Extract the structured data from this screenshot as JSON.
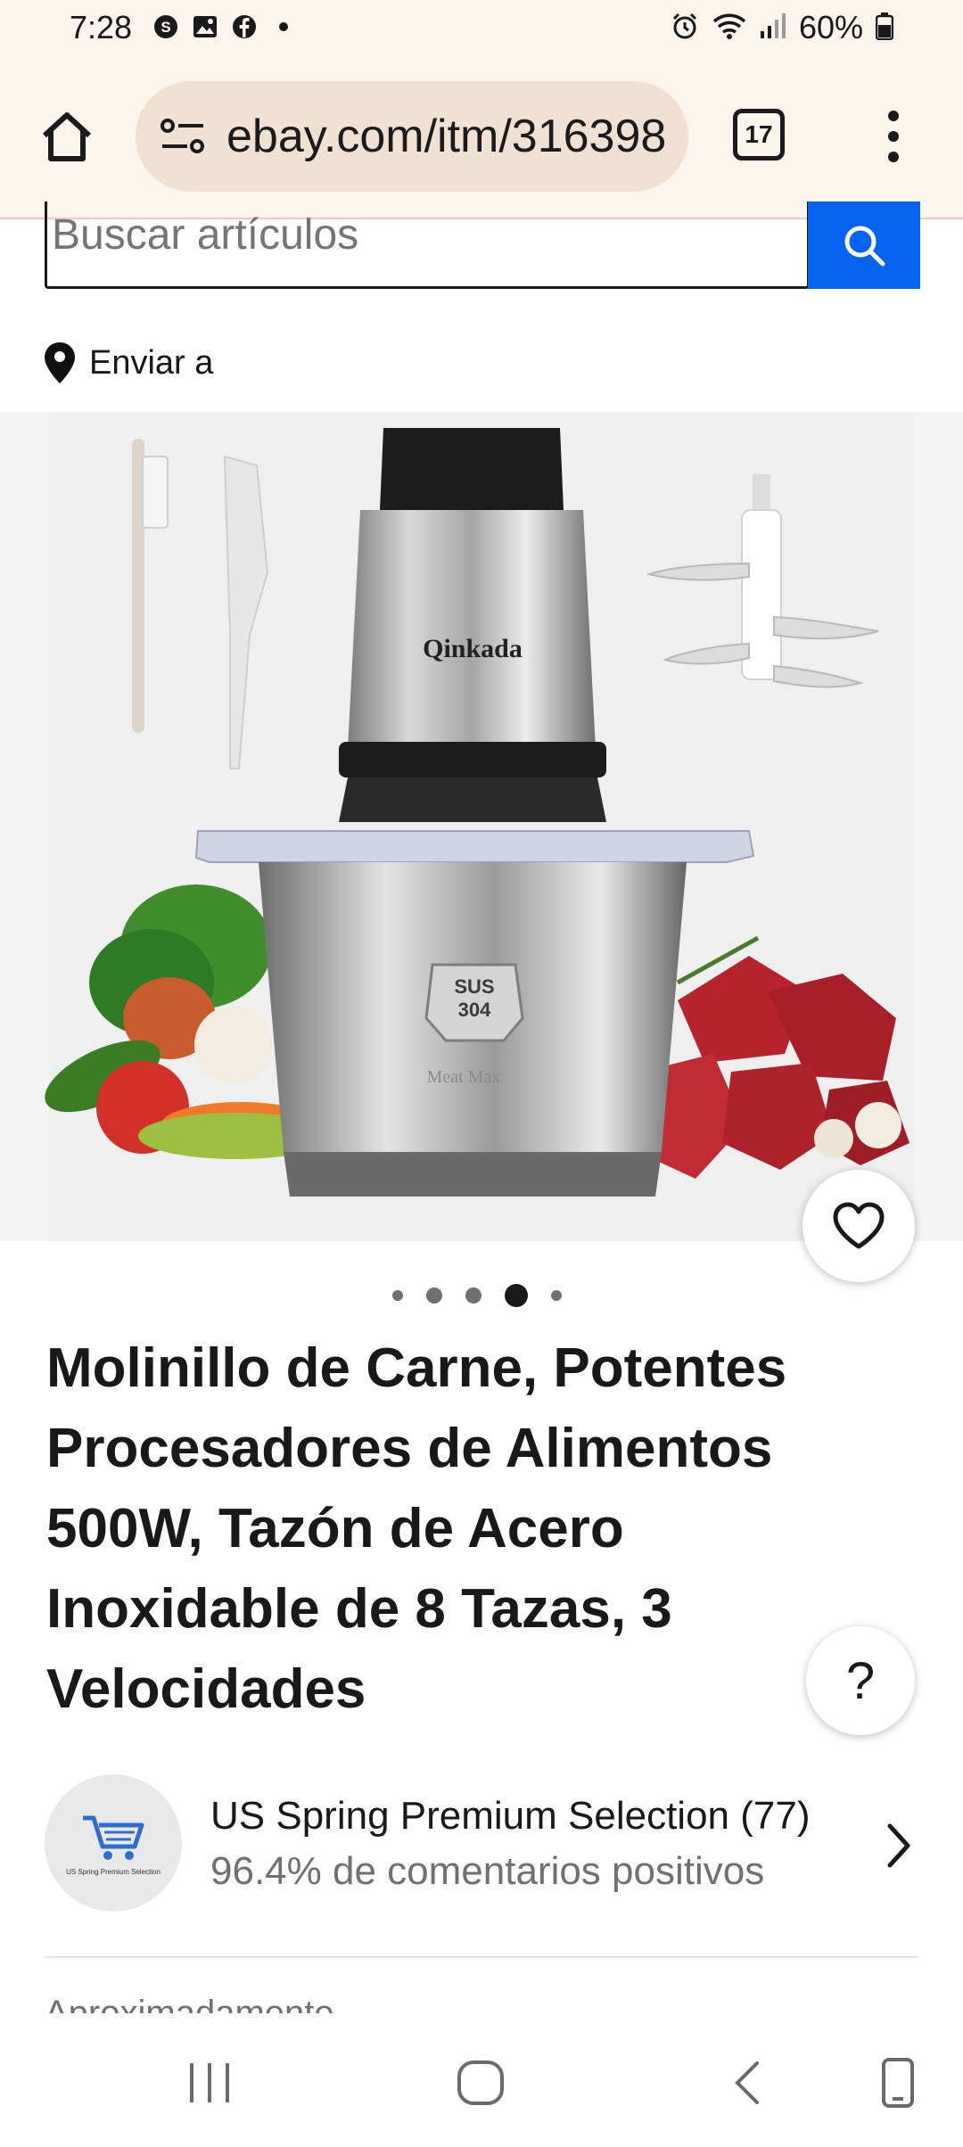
{
  "status_bar": {
    "time": "7:28",
    "battery": "60%"
  },
  "browser": {
    "url": "ebay.com/itm/316398",
    "tab_count": "17"
  },
  "search": {
    "placeholder": "Buscar artículos"
  },
  "ship_to": {
    "label": "Enviar a"
  },
  "product": {
    "brand_text": "Qinkada",
    "badge_line1": "SUS",
    "badge_line2": "304",
    "base_text": "Meat Max",
    "image_index": 4,
    "image_count": 5,
    "title": "Molinillo de Carne, Potentes Procesadores de Alimentos 500W, Tazón de Acero Inoxidable de 8 Tazas, 3 Velocidades"
  },
  "help": {
    "label": "?"
  },
  "seller": {
    "name": "US Spring Premium Selection (77)",
    "rating": "96.4% de comentarios positivos",
    "avatar_caption": "US Spring Premium Selection"
  },
  "next_section": {
    "peek": "Aproximadamente"
  },
  "colors": {
    "accent_blue": "#0563f0",
    "chrome_bg": "#fbf5ee",
    "url_pill": "#f1e1d2"
  }
}
